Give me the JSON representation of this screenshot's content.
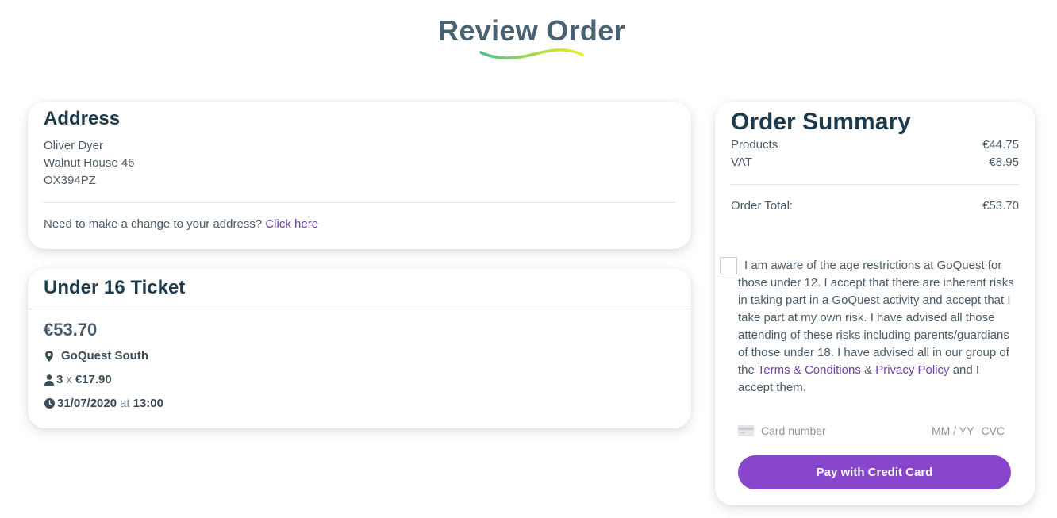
{
  "page": {
    "title": "Review Order"
  },
  "address": {
    "heading": "Address",
    "lines": [
      "Oliver Dyer",
      "Walnut House 46",
      "OX394PZ"
    ],
    "change_prompt": "Need to make a change to your address?",
    "change_link": "Click here"
  },
  "ticket": {
    "heading": "Under 16 Ticket",
    "price": "€53.70",
    "location": "GoQuest South",
    "quantity": "3",
    "times": "x",
    "unit_price": "€17.90",
    "date": "31/07/2020",
    "at": "at",
    "time": "13:00"
  },
  "summary": {
    "heading": "Order Summary",
    "products_label": "Products",
    "products_value": "€44.75",
    "vat_label": "VAT",
    "vat_value": "€8.95",
    "total_label": "Order Total:",
    "total_value": "€53.70",
    "terms_checked": false,
    "terms_text_1": "I am aware of the age restrictions at GoQuest for those under 12. I accept that there are inherent risks in taking part in a GoQuest activity and accept that I take part at my own risk. I have advised all those attending of these risks including parents/guardians of those under 18. I have advised all in our group of the",
    "terms_link": "Terms & Conditions",
    "terms_amp": "&",
    "privacy_link": "Privacy Policy",
    "terms_text_2": "and I accept them.",
    "card_placeholder": "Card number",
    "expiry_placeholder": "MM / YY",
    "cvc_placeholder": "CVC",
    "pay_label": "Pay with Credit Card"
  },
  "colors": {
    "accent": "#8846cc",
    "link": "#6e3fa8",
    "heading": "#1d3a4a",
    "title": "#4a6272"
  },
  "icons": [
    "map-marker-icon",
    "user-icon",
    "clock-icon",
    "credit-card-icon"
  ]
}
